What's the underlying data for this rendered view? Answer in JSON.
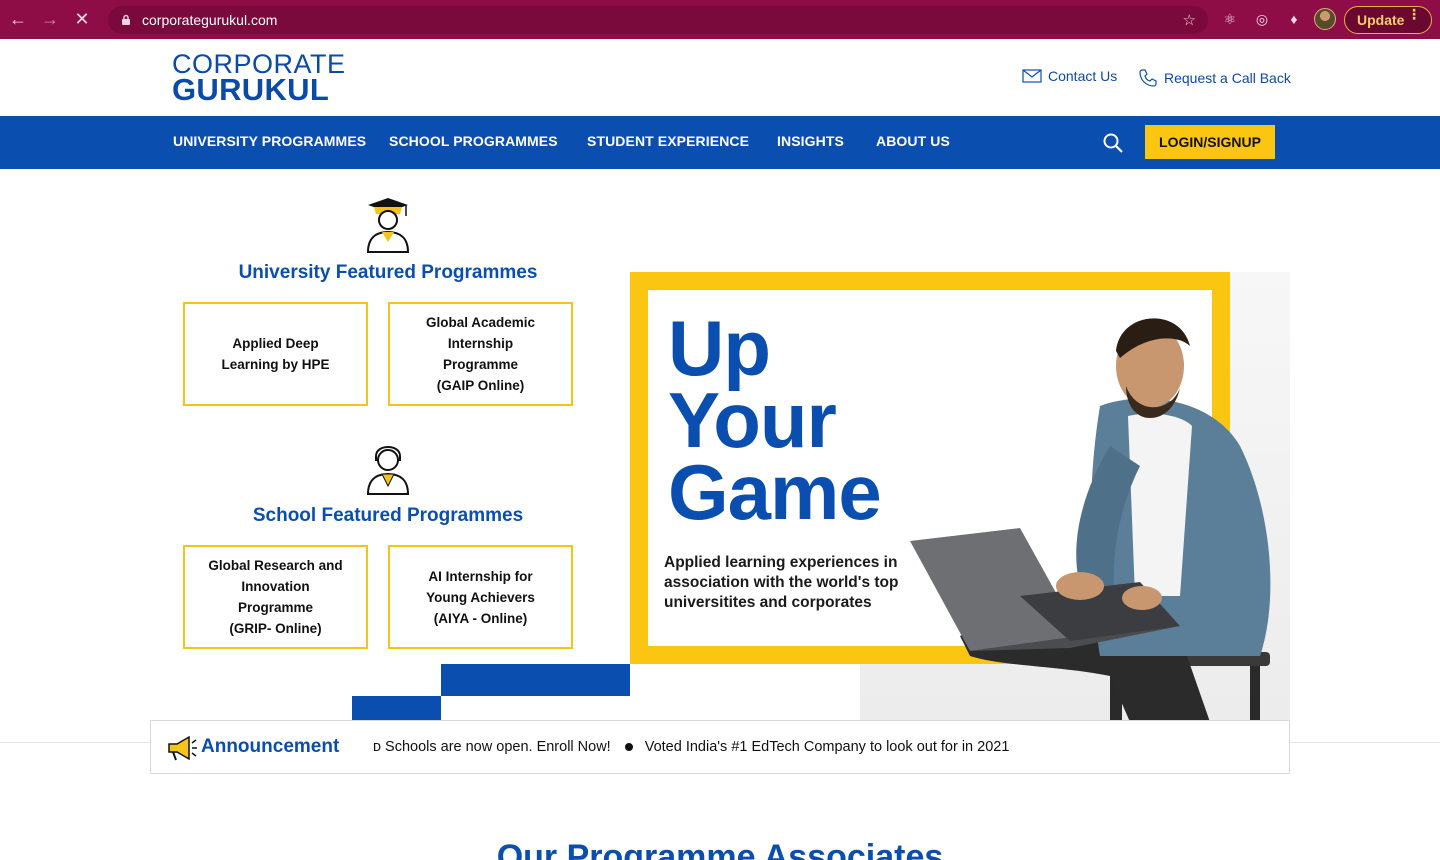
{
  "browser": {
    "url": "corporategurukul.com",
    "update_label": "Update"
  },
  "header": {
    "logo_line1": "CORPORATE",
    "logo_line2": "GURUKUL",
    "contact_label": "Contact Us",
    "callback_label": "Request a Call Back"
  },
  "nav": {
    "items": [
      "UNIVERSITY PROGRAMMES",
      "SCHOOL PROGRAMMES",
      "STUDENT EXPERIENCE",
      "INSIGHTS",
      "ABOUT US"
    ],
    "login_label": "LOGIN/SIGNUP"
  },
  "university": {
    "title": "University Featured Programmes",
    "cards": [
      "Applied Deep\nLearning by HPE",
      "Global Academic\nInternship\nProgramme\n(GAIP Online)"
    ]
  },
  "school": {
    "title": "School Featured Programmes",
    "cards": [
      "Global Research and\nInnovation\nProgramme\n(GRIP- Online)",
      "AI Internship for\nYoung Achievers\n(AIYA - Online)"
    ]
  },
  "hero": {
    "line1": "Up",
    "line2": "Your",
    "line3": "Game",
    "subtitle": "Applied learning experiences in association with the world's top universitites and corporates"
  },
  "announcement": {
    "title": "Announcement",
    "item1": "ᴅ Schools are now open. Enroll Now!",
    "item2": "Voted India's #1 EdTech Company to look out for in 2021"
  },
  "associates_title": "Our Programme Associates",
  "colors": {
    "brand_blue": "#0a4faf",
    "accent_yellow": "#fbc611",
    "chrome": "#8e0d46"
  }
}
